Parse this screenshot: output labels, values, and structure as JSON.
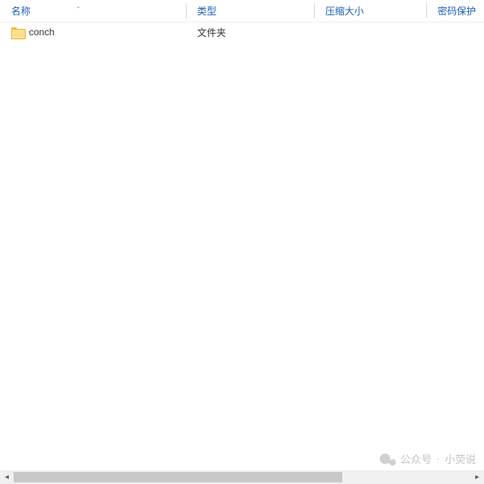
{
  "columns": {
    "name": "名称",
    "type": "类型",
    "compressed_size": "压缩大小",
    "password_protected": "密码保护"
  },
  "sort_indicator": "ˆ",
  "rows": [
    {
      "name": "conch",
      "type": "文件夹",
      "compressed_size": "",
      "password_protected": ""
    }
  ],
  "watermark": {
    "prefix": "公众号",
    "separator": "·",
    "name": "小荧说"
  }
}
